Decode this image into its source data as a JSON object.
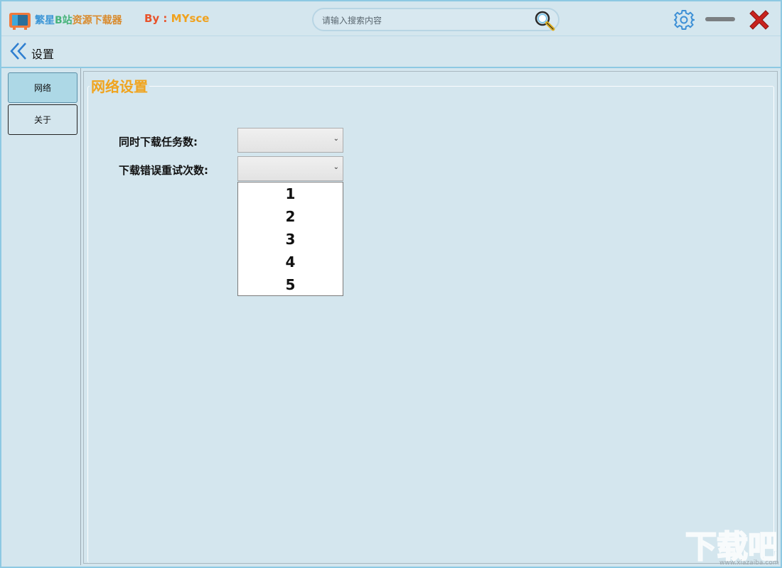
{
  "app": {
    "title_part1": "繁星",
    "title_part2": "B站",
    "title_part3": "资源下载器",
    "author_prefix": "By : ",
    "author_name": "MYsce"
  },
  "search": {
    "placeholder": "请输入搜索内容",
    "value": ""
  },
  "header": {
    "back_label": "设置"
  },
  "nav": {
    "items": [
      {
        "label": "网络",
        "active": true
      },
      {
        "label": "关于",
        "active": false
      }
    ]
  },
  "network_settings": {
    "group_title": "网络设置",
    "concurrent_label": "同时下载任务数:",
    "concurrent_value": "",
    "retry_label": "下载错误重试次数:",
    "retry_value": "",
    "retry_options": [
      "1",
      "2",
      "3",
      "4",
      "5"
    ]
  },
  "watermark": {
    "text": "下载吧",
    "url": "www.xiazaiba.com"
  },
  "colors": {
    "background": "#d4e6ee",
    "accent_border": "#8dc9e3",
    "group_title": "#f0a41e",
    "nav_active": "#add8e6"
  },
  "icons": [
    "tv-logo-icon",
    "search-icon",
    "gear-icon",
    "minimize-icon",
    "close-icon",
    "back-chevron-icon"
  ]
}
